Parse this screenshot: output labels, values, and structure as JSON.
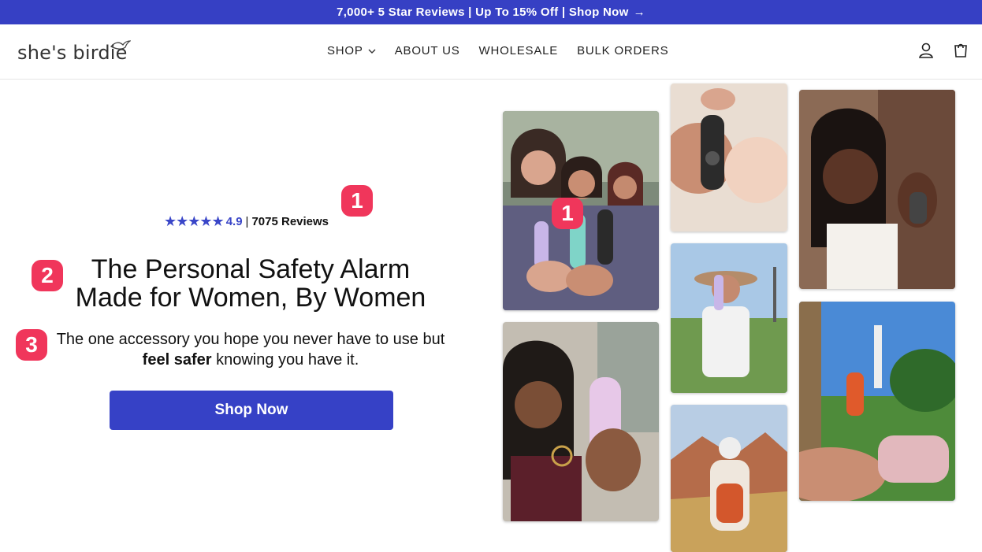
{
  "announcement": {
    "text": "7,000+ 5 Star Reviews | Up To 15% Off | Shop Now",
    "arrow": "→"
  },
  "brand": {
    "name": "she's birdie",
    "icon": "bird-icon"
  },
  "nav": {
    "items": [
      {
        "label": "SHOP"
      },
      {
        "label": "ABOUT US"
      },
      {
        "label": "WHOLESALE"
      },
      {
        "label": "BULK ORDERS"
      }
    ]
  },
  "header_icons": [
    "account-icon",
    "cart-icon"
  ],
  "hero": {
    "rating": {
      "stars": 5,
      "score": "4.9",
      "separator": "|",
      "reviews": "7075 Reviews"
    },
    "headline_line1": "The Personal Safety Alarm",
    "headline_line2": "Made for Women, By Women",
    "sub_part1": "The one accessory you hope you never have to use but",
    "sub_bold": "feel safer",
    "sub_part2": "knowing you have it.",
    "cta": "Shop Now"
  },
  "annotations": {
    "badge1": "1",
    "badge2": "2",
    "badge3": "3",
    "photo_badge": "1"
  },
  "colors": {
    "accent": "#3640c4",
    "badge": "#f0365b"
  }
}
